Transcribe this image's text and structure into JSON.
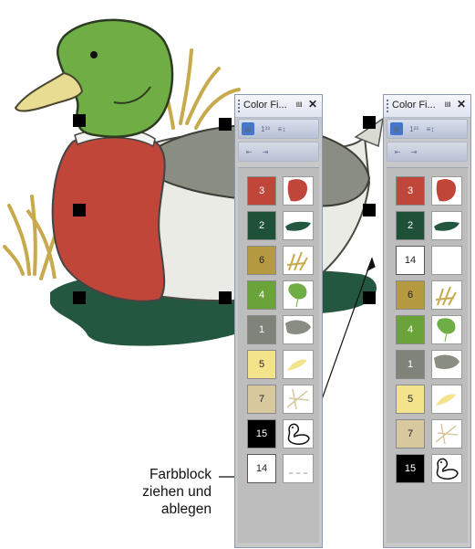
{
  "panels": [
    {
      "title": "Color Fi...",
      "pin_icon": "pin-icon",
      "close_icon": "close-icon",
      "rows": [
        {
          "number": "3",
          "color": "#c0463a",
          "thumb": "red-body"
        },
        {
          "number": "2",
          "color": "#1f5038",
          "thumb": "green-water"
        },
        {
          "number": "6",
          "color": "#b59a40",
          "thumb": "gold-grass"
        },
        {
          "number": "4",
          "color": "#6aa33a",
          "thumb": "green-head"
        },
        {
          "number": "1",
          "color": "#7f837a",
          "thumb": "gray-wing"
        },
        {
          "number": "5",
          "color": "#f3e38a",
          "thumb": "yellow-beak"
        },
        {
          "number": "7",
          "color": "#d8c89e",
          "thumb": "tan-lines"
        },
        {
          "number": "15",
          "color": "#000000",
          "thumb": "outline"
        },
        {
          "number": "14",
          "color": "#ffffff",
          "thumb": "dots"
        }
      ]
    },
    {
      "title": "Color Fi...",
      "pin_icon": "pin-icon",
      "close_icon": "close-icon",
      "rows": [
        {
          "number": "3",
          "color": "#c0463a",
          "thumb": "red-body"
        },
        {
          "number": "2",
          "color": "#1f5038",
          "thumb": "green-water"
        },
        {
          "number": "14",
          "color": "#ffffff",
          "thumb": "blank"
        },
        {
          "number": "6",
          "color": "#b59a40",
          "thumb": "gold-grass"
        },
        {
          "number": "4",
          "color": "#6aa33a",
          "thumb": "green-head"
        },
        {
          "number": "1",
          "color": "#7f837a",
          "thumb": "gray-wing"
        },
        {
          "number": "5",
          "color": "#f3e38a",
          "thumb": "yellow-beak"
        },
        {
          "number": "7",
          "color": "#d8c89e",
          "thumb": "tan-lines"
        },
        {
          "number": "15",
          "color": "#000000",
          "thumb": "outline"
        }
      ]
    }
  ],
  "toolbar_icons": [
    "color-palette-icon",
    "numbering-icon",
    "sort-icon",
    "move-up-icon",
    "move-down-icon"
  ],
  "instruction": {
    "line1": "Farbblock",
    "line2": "ziehen und",
    "line3": "ablegen"
  }
}
